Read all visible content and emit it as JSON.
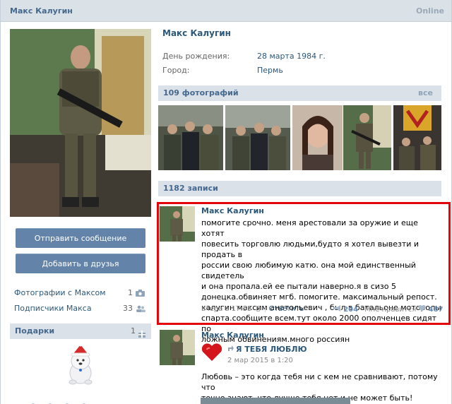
{
  "header": {
    "user_name": "Макс Калугин",
    "status": "Online"
  },
  "profile": {
    "name": "Макс Калугин",
    "birthday_label": "День рождения:",
    "birthday_value": "28 марта 1984 г.",
    "city_label": "Город:",
    "city_value": "Пермь"
  },
  "actions": {
    "send_message": "Отправить сообщение",
    "add_friend": "Добавить в друзья"
  },
  "links": [
    {
      "label": "Фотографии с Максом",
      "count": "1",
      "icon": "camera-icon"
    },
    {
      "label": "Подписчики Макса",
      "count": "33",
      "icon": "people-icon"
    }
  ],
  "gifts": {
    "title": "Подарки",
    "count": "1",
    "icon": "gift-icon"
  },
  "photos": {
    "title": "109 фотографий",
    "all_label": "все"
  },
  "wall": {
    "title": "1182 записи"
  },
  "posts": [
    {
      "author": "Макс Калугин",
      "text": "помогите срочно. меня арестовали за оружие и еще хотят\nповесить торговлю людьми,будто я хотел вывезти и продать в\nроссии свою любимую катю. она мой единственный свидетель\nи она пропала.ей ее пытали наверно.я в сизо 5\nдонецка.обвиняет мгб. помогите. максимальный репост.\nкалугин максим анатольевич , был в батальоне моторолы\nспарта.сообщите всем.тут около 2000 ополченцев сидят по\nложным обвинениям.много россиян",
      "time": "вчера в 17:55",
      "reply_label": "Ответить",
      "reposts": "204",
      "like_label": "Мне нравится",
      "likes": "487"
    },
    {
      "author": "Макс Калугин",
      "shared_title": "Я ТЕБЯ ЛЮБЛЮ",
      "shared_date": "2 мар 2015 в 1:20",
      "text": "Любовь – это когда тебя ни с кем не сравнивают, потому что\nточно знают, что лучше тебя нет и не может быть!"
    }
  ],
  "colors": {
    "accent": "#2b587a",
    "button": "#6383a8",
    "highlight": "#e4050b",
    "header_bg": "#dae2e8"
  }
}
